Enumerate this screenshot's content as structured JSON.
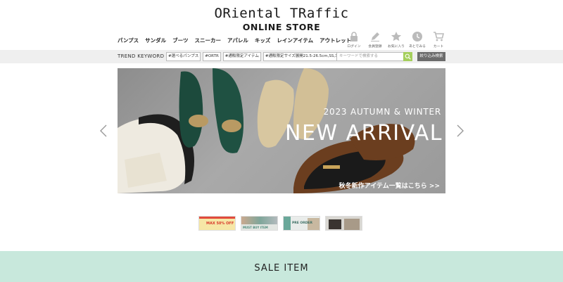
{
  "header": {
    "logo_main": "ORiental TRaffic",
    "logo_sub": "ONLINE STORE"
  },
  "nav": {
    "items": [
      {
        "label": "パンプス"
      },
      {
        "label": "サンダル"
      },
      {
        "label": "ブーツ"
      },
      {
        "label": "スニーカー"
      },
      {
        "label": "アパレル"
      },
      {
        "label": "キッズ"
      },
      {
        "label": "レインアイテム"
      },
      {
        "label": "アウトレット"
      }
    ]
  },
  "account_icons": [
    {
      "label": "ログイン",
      "icon": "lock-icon"
    },
    {
      "label": "会員登録",
      "icon": "pencil-icon"
    },
    {
      "label": "お気に入り",
      "icon": "star-icon"
    },
    {
      "label": "あとでみる",
      "icon": "clock-icon"
    },
    {
      "label": "カート",
      "icon": "cart-icon"
    }
  ],
  "keyword_bar": {
    "title": "TREND KEYWORD",
    "tags": [
      {
        "label": "#選べるパンプス"
      },
      {
        "label": "#ORTR"
      },
      {
        "label": "#通販限定アイテム"
      },
      {
        "label": "#通販限定サイズ展開21.5-26.5cm,SS,3L"
      }
    ],
    "search_placeholder": "キーワードで検索する",
    "search_icon": "search-icon",
    "refine_label": "絞り込み検索",
    "background": "#efefef",
    "search_button_color": "#a5cf5c"
  },
  "hero": {
    "subtitle": "2023 AUTUMN & WINTER",
    "title": "NEW ARRIVAL",
    "link": "秋冬新作アイテム一覧はこちら >>",
    "prev_icon": "chevron-left-icon",
    "next_icon": "chevron-right-icon"
  },
  "thumbnails": [
    {
      "text": "MAX 50% OFF"
    },
    {
      "text": "MUST BUY ITEM"
    },
    {
      "text": "PRE ORDER"
    },
    {
      "text": ""
    }
  ],
  "sale": {
    "title": "SALE ITEM",
    "background": "#c8e8dc"
  }
}
